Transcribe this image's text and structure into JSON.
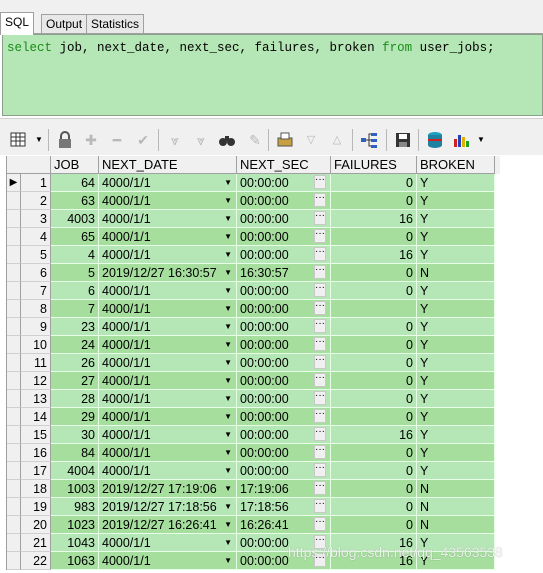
{
  "tabs": [
    "SQL",
    "Output",
    "Statistics"
  ],
  "sql": {
    "kw_select": "select",
    "middle": " job, next_date, next_sec, failures, broken ",
    "kw_from": "from",
    "tail": " user_jobs;"
  },
  "toolbar": {
    "icons": [
      "grid-icon",
      "lock-icon",
      "plus-icon",
      "minus-icon",
      "check-icon",
      "filter-down-icon",
      "filter-icon",
      "binoculars-icon",
      "eraser-icon",
      "print-icon",
      "arrow-down-icon",
      "arrow-up-icon",
      "tree-icon",
      "save-icon",
      "database-icon",
      "chart-icon"
    ]
  },
  "grid": {
    "columns": [
      "JOB",
      "NEXT_DATE",
      "NEXT_SEC",
      "FAILURES",
      "BROKEN"
    ],
    "rows": [
      {
        "no": "1",
        "job": "64",
        "next_date": "4000/1/1",
        "next_sec": "00:00:00",
        "failures": "0",
        "broken": "Y"
      },
      {
        "no": "2",
        "job": "63",
        "next_date": "4000/1/1",
        "next_sec": "00:00:00",
        "failures": "0",
        "broken": "Y"
      },
      {
        "no": "3",
        "job": "4003",
        "next_date": "4000/1/1",
        "next_sec": "00:00:00",
        "failures": "16",
        "broken": "Y"
      },
      {
        "no": "4",
        "job": "65",
        "next_date": "4000/1/1",
        "next_sec": "00:00:00",
        "failures": "0",
        "broken": "Y"
      },
      {
        "no": "5",
        "job": "4",
        "next_date": "4000/1/1",
        "next_sec": "00:00:00",
        "failures": "16",
        "broken": "Y"
      },
      {
        "no": "6",
        "job": "5",
        "next_date": "2019/12/27 16:30:57",
        "next_sec": "16:30:57",
        "failures": "0",
        "broken": "N"
      },
      {
        "no": "7",
        "job": "6",
        "next_date": "4000/1/1",
        "next_sec": "00:00:00",
        "failures": "0",
        "broken": "Y"
      },
      {
        "no": "8",
        "job": "7",
        "next_date": "4000/1/1",
        "next_sec": "00:00:00",
        "failures": "",
        "broken": "Y"
      },
      {
        "no": "9",
        "job": "23",
        "next_date": "4000/1/1",
        "next_sec": "00:00:00",
        "failures": "0",
        "broken": "Y"
      },
      {
        "no": "10",
        "job": "24",
        "next_date": "4000/1/1",
        "next_sec": "00:00:00",
        "failures": "0",
        "broken": "Y"
      },
      {
        "no": "11",
        "job": "26",
        "next_date": "4000/1/1",
        "next_sec": "00:00:00",
        "failures": "0",
        "broken": "Y"
      },
      {
        "no": "12",
        "job": "27",
        "next_date": "4000/1/1",
        "next_sec": "00:00:00",
        "failures": "0",
        "broken": "Y"
      },
      {
        "no": "13",
        "job": "28",
        "next_date": "4000/1/1",
        "next_sec": "00:00:00",
        "failures": "0",
        "broken": "Y"
      },
      {
        "no": "14",
        "job": "29",
        "next_date": "4000/1/1",
        "next_sec": "00:00:00",
        "failures": "0",
        "broken": "Y"
      },
      {
        "no": "15",
        "job": "30",
        "next_date": "4000/1/1",
        "next_sec": "00:00:00",
        "failures": "16",
        "broken": "Y"
      },
      {
        "no": "16",
        "job": "84",
        "next_date": "4000/1/1",
        "next_sec": "00:00:00",
        "failures": "0",
        "broken": "Y"
      },
      {
        "no": "17",
        "job": "4004",
        "next_date": "4000/1/1",
        "next_sec": "00:00:00",
        "failures": "0",
        "broken": "Y"
      },
      {
        "no": "18",
        "job": "1003",
        "next_date": "2019/12/27 17:19:06",
        "next_sec": "17:19:06",
        "failures": "0",
        "broken": "N"
      },
      {
        "no": "19",
        "job": "983",
        "next_date": "2019/12/27 17:18:56",
        "next_sec": "17:18:56",
        "failures": "0",
        "broken": "N"
      },
      {
        "no": "20",
        "job": "1023",
        "next_date": "2019/12/27 16:26:41",
        "next_sec": "16:26:41",
        "failures": "0",
        "broken": "N"
      },
      {
        "no": "21",
        "job": "1043",
        "next_date": "4000/1/1",
        "next_sec": "00:00:00",
        "failures": "16",
        "broken": "Y"
      },
      {
        "no": "22",
        "job": "1063",
        "next_date": "4000/1/1",
        "next_sec": "00:00:00",
        "failures": "16",
        "broken": "Y"
      }
    ]
  },
  "watermark": "https://blog.csdn.net/qq_43563538",
  "colors": {
    "editor_bg": "#b5e6b5",
    "row_light": "#b5e6b5",
    "row_dark": "#a6de9e",
    "keyword": "#1a8c1a"
  }
}
